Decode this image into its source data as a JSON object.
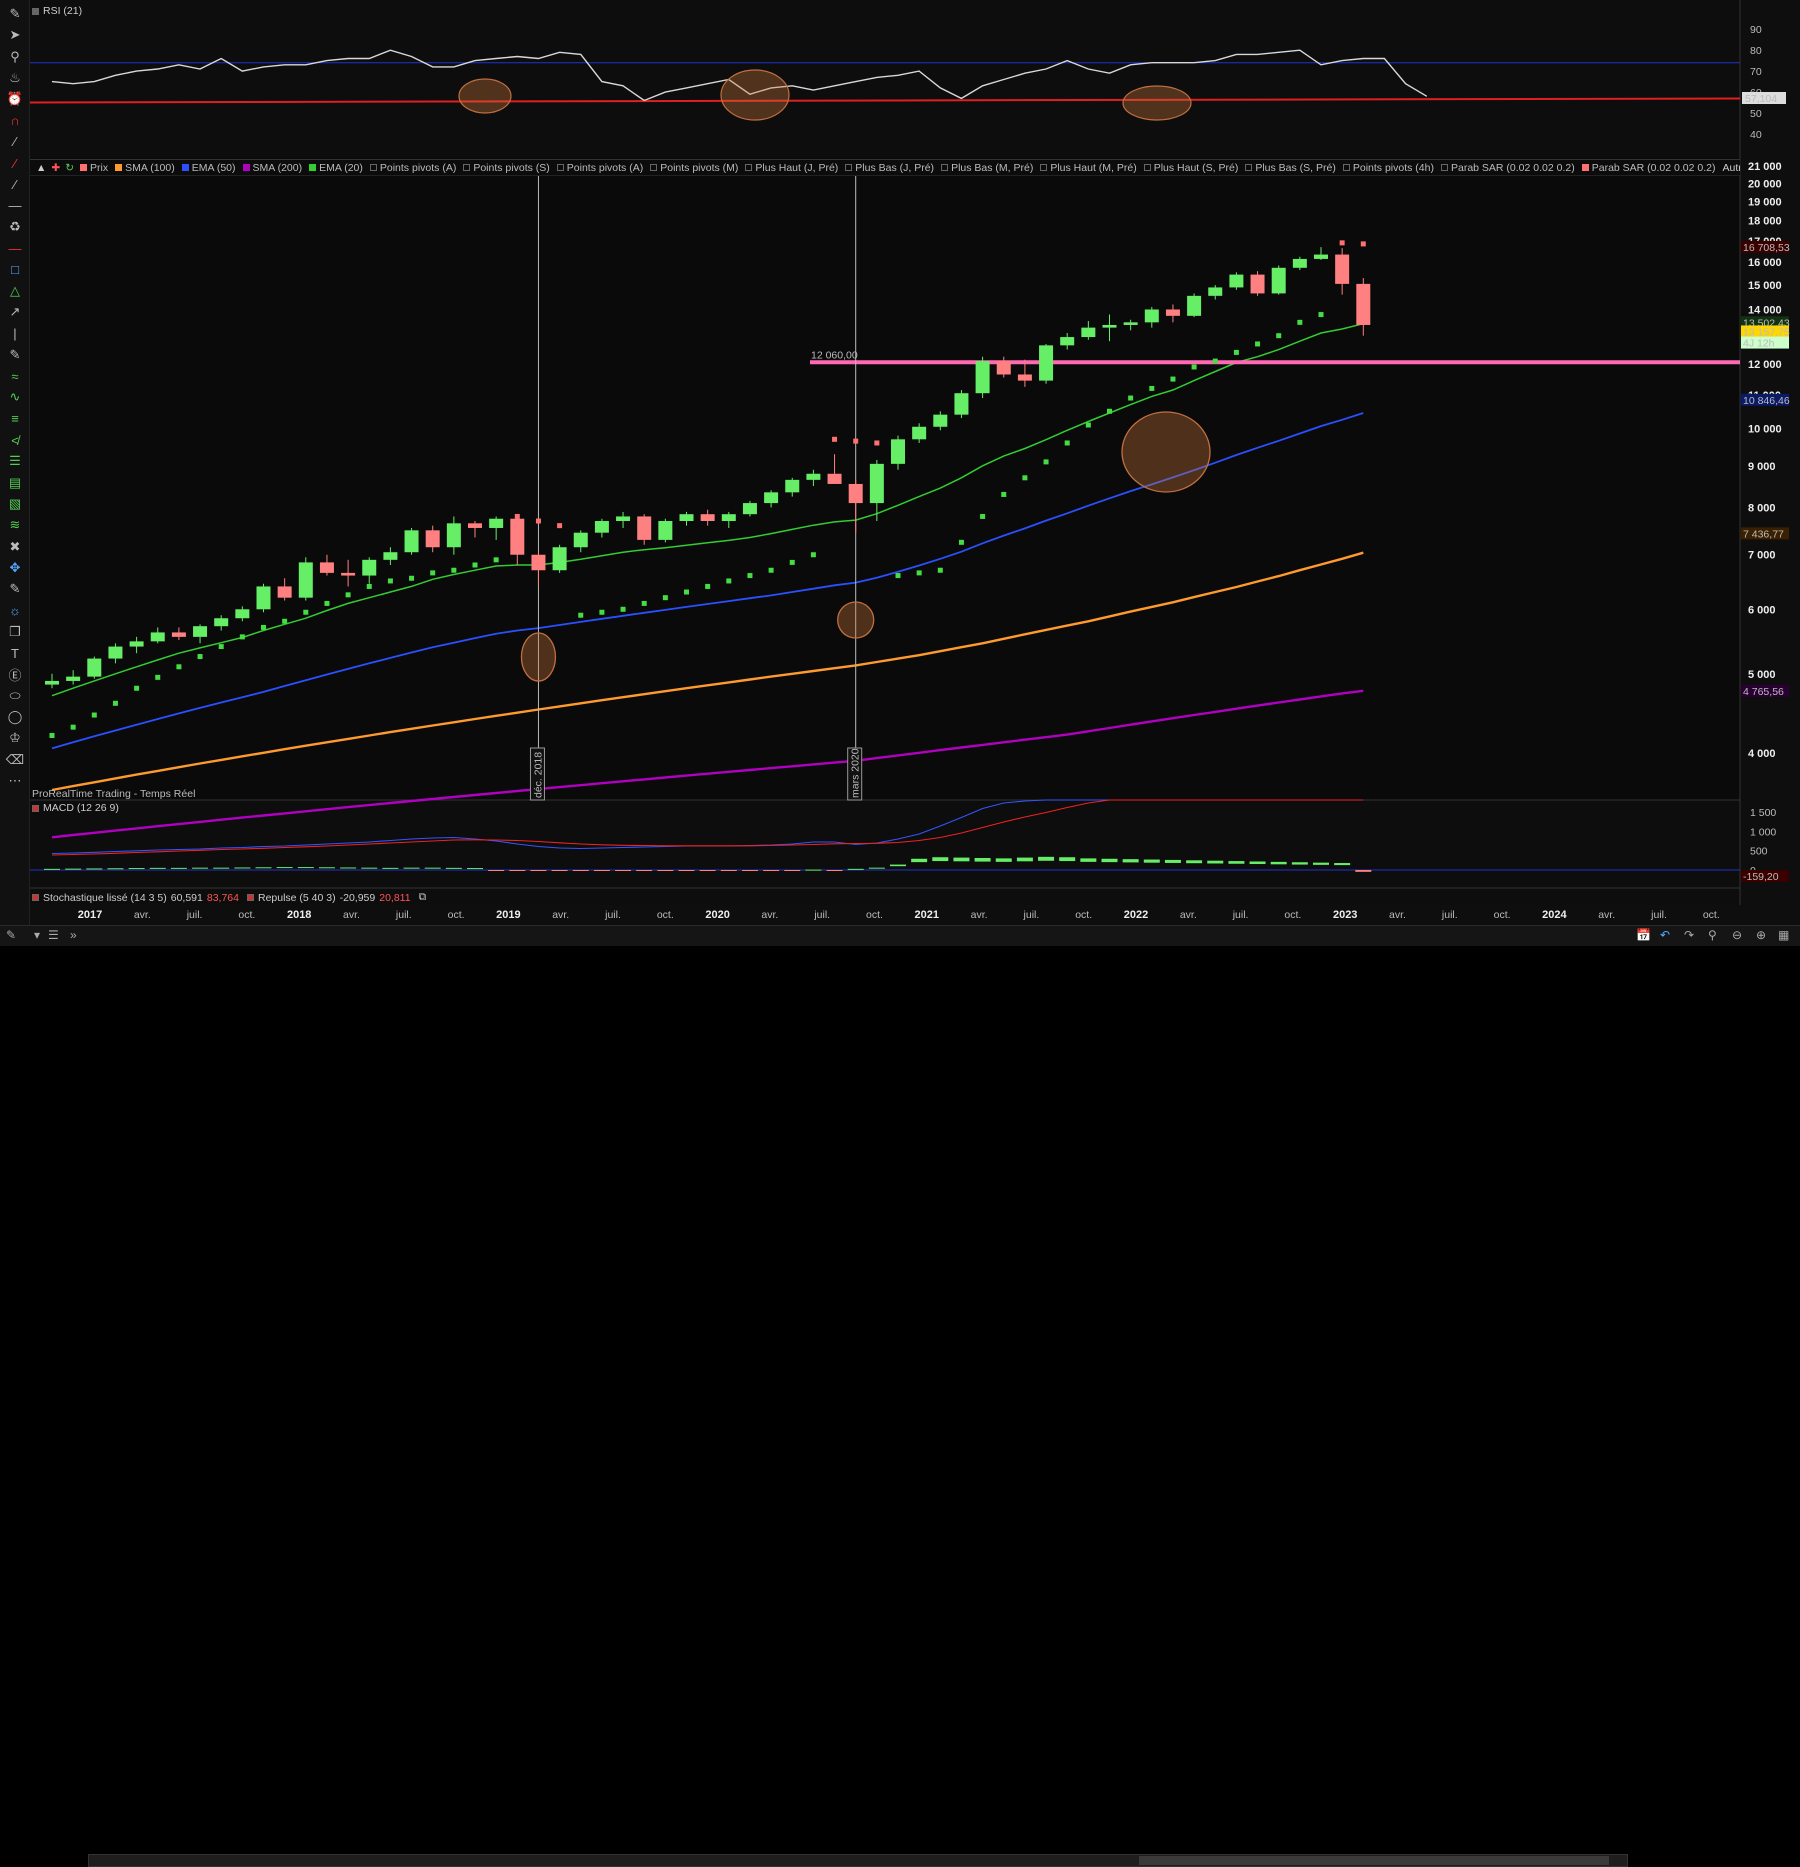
{
  "rsi": {
    "label": "RSI (21)",
    "levels": [
      "90",
      "80",
      "70",
      "60",
      "50",
      "40"
    ],
    "current": "57,104",
    "values": [
      65,
      64,
      65,
      68,
      70,
      71,
      73,
      71,
      76,
      70,
      72,
      73,
      73,
      75,
      76,
      76,
      80,
      77,
      72,
      72,
      75,
      76,
      77,
      76,
      79,
      78,
      65,
      63,
      56,
      60,
      62,
      64,
      66,
      59,
      62,
      63,
      61,
      63,
      65,
      67,
      68,
      70,
      62,
      57,
      63,
      66,
      69,
      71,
      75,
      71,
      69,
      73,
      74,
      74,
      74,
      75,
      78,
      78,
      79,
      80,
      73,
      75,
      76,
      76,
      64,
      58
    ],
    "upper_line": 74,
    "lower_line": 56
  },
  "legend": [
    {
      "label": "Prix",
      "color": "#ff7070",
      "checked": true
    },
    {
      "label": "SMA (100)",
      "color": "#ff9a2e",
      "checked": true
    },
    {
      "label": "EMA (50)",
      "color": "#2a50ff",
      "checked": true
    },
    {
      "label": "SMA (200)",
      "color": "#b000c0",
      "checked": true
    },
    {
      "label": "EMA (20)",
      "color": "#33cc33",
      "checked": true
    },
    {
      "label": "Points pivots (A)",
      "color": "",
      "checked": false
    },
    {
      "label": "Points pivots (S)",
      "color": "",
      "checked": false
    },
    {
      "label": "Points pivots (A)",
      "color": "",
      "checked": false
    },
    {
      "label": "Points pivots (M)",
      "color": "",
      "checked": false
    },
    {
      "label": "Plus Haut (J, Pré)",
      "color": "",
      "checked": false
    },
    {
      "label": "Plus Bas (J, Pré)",
      "color": "",
      "checked": false
    },
    {
      "label": "Plus Bas (M, Pré)",
      "color": "",
      "checked": false
    },
    {
      "label": "Plus Haut (M, Pré)",
      "color": "",
      "checked": false
    },
    {
      "label": "Plus Haut (S, Pré)",
      "color": "",
      "checked": false
    },
    {
      "label": "Plus Bas (S, Pré)",
      "color": "",
      "checked": false
    },
    {
      "label": "Points pivots (4h)",
      "color": "",
      "checked": false
    },
    {
      "label": "Parab SAR (0.02 0.02 0.2)",
      "color": "",
      "checked": false
    },
    {
      "label": "Parab SAR (0.02 0.02 0.2)",
      "color": "#ff7070",
      "checked": true
    }
  ],
  "legend_more": "Autres",
  "price_axis": {
    "ticks": [
      "21 000",
      "20 000",
      "19 000",
      "18 000",
      "17 000",
      "16 000",
      "15 000",
      "14 000",
      "13 000",
      "12 000",
      "11 000",
      "10 000",
      "9 000",
      "8 000",
      "7 000",
      "6 000",
      "5 000",
      "4 000"
    ],
    "tags": [
      {
        "text": "16 708,53",
        "bg": "#3a0000",
        "fg": "#ff6666",
        "value": 16708
      },
      {
        "text": "13 502,43",
        "bg": "#113311",
        "fg": "#66ff66",
        "value": 13502
      },
      {
        "text": "13 157,75",
        "bg": "#ffd700",
        "fg": "#000000",
        "value": 13157
      },
      {
        "text": "4J 12h",
        "bg": "#ccffcc",
        "fg": "#000000",
        "value": 12750
      },
      {
        "text": "10 846,46",
        "bg": "#0a1a66",
        "fg": "#6688ff",
        "value": 10846
      },
      {
        "text": "7 436,77",
        "bg": "#3a2000",
        "fg": "#ffaa44",
        "value": 7436
      },
      {
        "text": "4 765,56",
        "bg": "#2a0033",
        "fg": "#dd55ff",
        "value": 4765
      }
    ]
  },
  "hline": {
    "label": "12 060,00",
    "value": 12060,
    "color": "#ff69b4"
  },
  "vlines": [
    {
      "label": "déc. 2018"
    },
    {
      "label": "mars 2020"
    }
  ],
  "watermark": "ProRealTime Trading - Temps Réel",
  "macd": {
    "label": "MACD (12 26 9)",
    "ticks": [
      "1 500",
      "1 000",
      "500",
      "0"
    ],
    "current": "-159,20"
  },
  "stoch": {
    "label1": "Stochastique lissé (14 3 5)",
    "val1a": "60,591",
    "val1b": "83,764",
    "label2": "Repulse (5 40 3)",
    "val2a": "-20,959",
    "val2b": "20,811"
  },
  "time_axis": [
    "2017",
    "avr.",
    "juil.",
    "oct.",
    "2018",
    "avr.",
    "juil.",
    "oct.",
    "2019",
    "avr.",
    "juil.",
    "oct.",
    "2020",
    "avr.",
    "juil.",
    "oct.",
    "2021",
    "avr.",
    "juil.",
    "oct.",
    "2022",
    "avr.",
    "juil.",
    "oct.",
    "2023",
    "avr.",
    "juil.",
    "oct.",
    "2024",
    "avr.",
    "juil.",
    "oct."
  ],
  "chart_data": {
    "type": "candlestick",
    "start": "2017-01",
    "interval": "month",
    "candles": [
      [
        4850,
        5000,
        4800,
        4900
      ],
      [
        4900,
        5050,
        4850,
        4960
      ],
      [
        4960,
        5250,
        4930,
        5220
      ],
      [
        5220,
        5450,
        5150,
        5400
      ],
      [
        5400,
        5550,
        5300,
        5480
      ],
      [
        5480,
        5700,
        5450,
        5620
      ],
      [
        5620,
        5700,
        5500,
        5550
      ],
      [
        5550,
        5750,
        5450,
        5720
      ],
      [
        5720,
        5900,
        5650,
        5850
      ],
      [
        5850,
        6050,
        5800,
        6000
      ],
      [
        6000,
        6450,
        5950,
        6400
      ],
      [
        6400,
        6550,
        6150,
        6200
      ],
      [
        6200,
        6950,
        6150,
        6850
      ],
      [
        6850,
        7000,
        6600,
        6650
      ],
      [
        6650,
        6900,
        6400,
        6600
      ],
      [
        6600,
        6950,
        6450,
        6900
      ],
      [
        6900,
        7150,
        6800,
        7050
      ],
      [
        7050,
        7550,
        7000,
        7500
      ],
      [
        7500,
        7600,
        7050,
        7150
      ],
      [
        7150,
        7800,
        7000,
        7650
      ],
      [
        7650,
        7700,
        7350,
        7550
      ],
      [
        7550,
        7800,
        7300,
        7750
      ],
      [
        7750,
        7700,
        6800,
        7000
      ],
      [
        7000,
        7050,
        6400,
        6700
      ],
      [
        6700,
        7200,
        6650,
        7150
      ],
      [
        7150,
        7500,
        7050,
        7450
      ],
      [
        7450,
        7750,
        7350,
        7700
      ],
      [
        7700,
        7900,
        7550,
        7800
      ],
      [
        7800,
        7850,
        7200,
        7300
      ],
      [
        7300,
        7750,
        7250,
        7700
      ],
      [
        7700,
        7900,
        7600,
        7850
      ],
      [
        7850,
        7950,
        7600,
        7700
      ],
      [
        7700,
        7900,
        7550,
        7850
      ],
      [
        7850,
        8150,
        7800,
        8100
      ],
      [
        8100,
        8400,
        8000,
        8350
      ],
      [
        8350,
        8700,
        8250,
        8650
      ],
      [
        8650,
        8900,
        8500,
        8800
      ],
      [
        8800,
        9300,
        8550,
        8550
      ],
      [
        8550,
        8650,
        7450,
        8100
      ],
      [
        8100,
        9150,
        7700,
        9050
      ],
      [
        9050,
        9800,
        8900,
        9700
      ],
      [
        9700,
        10150,
        9600,
        10050
      ],
      [
        10050,
        10500,
        9950,
        10400
      ],
      [
        10400,
        11150,
        10300,
        11050
      ],
      [
        11050,
        12250,
        10900,
        12100
      ],
      [
        12100,
        12250,
        11550,
        11650
      ],
      [
        11650,
        12150,
        11250,
        11450
      ],
      [
        11450,
        12700,
        11350,
        12650
      ],
      [
        12650,
        13100,
        12500,
        12950
      ],
      [
        12950,
        13550,
        12850,
        13300
      ],
      [
        13300,
        13800,
        12800,
        13400
      ],
      [
        13400,
        13600,
        13200,
        13500
      ],
      [
        13500,
        14100,
        13300,
        14000
      ],
      [
        14000,
        14200,
        13500,
        13750
      ],
      [
        13750,
        14650,
        13700,
        14550
      ],
      [
        14550,
        15000,
        14400,
        14900
      ],
      [
        14900,
        15550,
        14800,
        15450
      ],
      [
        15450,
        15600,
        14550,
        14650
      ],
      [
        14650,
        15850,
        14600,
        15750
      ],
      [
        15750,
        16250,
        15650,
        16150
      ],
      [
        16150,
        16700,
        16100,
        16350
      ],
      [
        16350,
        16650,
        14600,
        15050
      ],
      [
        15050,
        15300,
        13000,
        13400
      ]
    ],
    "sar": [
      4200,
      4300,
      4450,
      4600,
      4800,
      4950,
      5100,
      5250,
      5400,
      5550,
      5700,
      5800,
      5950,
      6100,
      6250,
      6400,
      6500,
      6550,
      6650,
      6700,
      6800,
      6900,
      7800,
      7700,
      7600,
      5900,
      5950,
      6000,
      6100,
      6200,
      6300,
      6400,
      6500,
      6600,
      6700,
      6850,
      7000,
      9700,
      9650,
      9600,
      6600,
      6650,
      6700,
      7250,
      7800,
      8300,
      8700,
      9100,
      9600,
      10100,
      10500,
      10900,
      11200,
      11500,
      11900,
      12100,
      12400,
      12700,
      13000,
      13500,
      13800,
      16900,
      16850
    ],
    "ema20": [
      4700,
      4800,
      4900,
      5000,
      5100,
      5200,
      5300,
      5380,
      5460,
      5540,
      5650,
      5750,
      5850,
      5980,
      6100,
      6200,
      6300,
      6400,
      6530,
      6620,
      6700,
      6780,
      6800,
      6800,
      6850,
      6910,
      6980,
      7050,
      7100,
      7140,
      7190,
      7240,
      7290,
      7350,
      7430,
      7520,
      7610,
      7680,
      7720,
      7860,
      8050,
      8250,
      8450,
      8700,
      9000,
      9250,
      9450,
      9690,
      9950,
      10200,
      10450,
      10700,
      10950,
      11150,
      11450,
      11750,
      12050,
      12250,
      12500,
      12800,
      13100,
      13250,
      13450
    ],
    "ema50": [
      4050,
      4120,
      4190,
      4260,
      4330,
      4400,
      4470,
      4540,
      4610,
      4680,
      4750,
      4830,
      4910,
      4990,
      5070,
      5150,
      5230,
      5310,
      5390,
      5460,
      5530,
      5600,
      5650,
      5690,
      5740,
      5790,
      5840,
      5890,
      5940,
      5990,
      6040,
      6090,
      6140,
      6190,
      6240,
      6300,
      6360,
      6420,
      6470,
      6560,
      6670,
      6790,
      6920,
      7060,
      7230,
      7390,
      7540,
      7710,
      7870,
      8040,
      8210,
      8380,
      8540,
      8710,
      8890,
      9080,
      9280,
      9470,
      9660,
      9860,
      10070,
      10250,
      10450
    ],
    "sma100": [
      3600,
      3640,
      3680,
      3720,
      3760,
      3800,
      3840,
      3880,
      3920,
      3960,
      4000,
      4040,
      4080,
      4120,
      4160,
      4200,
      4240,
      4280,
      4320,
      4360,
      4400,
      4440,
      4480,
      4520,
      4560,
      4600,
      4640,
      4680,
      4720,
      4760,
      4800,
      4840,
      4880,
      4920,
      4960,
      5000,
      5040,
      5080,
      5120,
      5170,
      5220,
      5270,
      5330,
      5390,
      5450,
      5520,
      5590,
      5660,
      5730,
      5800,
      5880,
      5960,
      6040,
      6120,
      6210,
      6300,
      6390,
      6490,
      6590,
      6700,
      6810,
      6920,
      7040
    ],
    "sma200": [
      3150,
      3170,
      3190,
      3210,
      3230,
      3250,
      3270,
      3290,
      3310,
      3330,
      3350,
      3370,
      3390,
      3410,
      3430,
      3450,
      3470,
      3490,
      3510,
      3530,
      3550,
      3570,
      3590,
      3610,
      3630,
      3650,
      3670,
      3690,
      3710,
      3730,
      3750,
      3770,
      3790,
      3810,
      3830,
      3850,
      3870,
      3890,
      3910,
      3940,
      3970,
      4000,
      4030,
      4060,
      4090,
      4120,
      4150,
      4180,
      4210,
      4250,
      4290,
      4330,
      4370,
      4410,
      4450,
      4490,
      4530,
      4570,
      4610,
      4650,
      4690,
      4730,
      4765
    ],
    "macd_hist": [
      30,
      35,
      40,
      45,
      50,
      55,
      55,
      60,
      60,
      65,
      70,
      75,
      75,
      70,
      65,
      60,
      55,
      60,
      60,
      55,
      50,
      -40,
      -60,
      -55,
      -50,
      -45,
      -40,
      -35,
      -35,
      -30,
      -30,
      -25,
      -25,
      -20,
      -15,
      -10,
      10,
      -30,
      30,
      60,
      140,
      290,
      330,
      320,
      310,
      300,
      320,
      340,
      330,
      300,
      290,
      280,
      270,
      260,
      250,
      240,
      230,
      220,
      210,
      200,
      190,
      180,
      -159
    ],
    "macd_line": [
      330,
      340,
      355,
      370,
      385,
      400,
      410,
      420,
      440,
      450,
      470,
      480,
      500,
      520,
      540,
      560,
      590,
      620,
      640,
      650,
      620,
      580,
      520,
      470,
      440,
      430,
      440,
      450,
      460,
      470,
      480,
      480,
      480,
      490,
      500,
      520,
      560,
      560,
      510,
      540,
      620,
      720,
      880,
      1050,
      1230,
      1340,
      1380,
      1470,
      1540,
      1620,
      1700,
      1760,
      1820,
      1880,
      1950,
      2030,
      2110,
      2180,
      2240,
      2300,
      2330,
      2280,
      2150
    ],
    "macd_signal": [
      300,
      310,
      320,
      335,
      350,
      365,
      380,
      395,
      410,
      420,
      435,
      450,
      465,
      480,
      500,
      520,
      540,
      560,
      580,
      600,
      605,
      600,
      590,
      570,
      545,
      520,
      505,
      495,
      490,
      485,
      485,
      485,
      485,
      485,
      490,
      500,
      510,
      525,
      530,
      535,
      550,
      590,
      650,
      740,
      850,
      960,
      1060,
      1150,
      1250,
      1340,
      1430,
      1520,
      1600,
      1680,
      1760,
      1840,
      1920,
      2000,
      2080,
      2150,
      2220,
      2270,
      2300
    ]
  }
}
